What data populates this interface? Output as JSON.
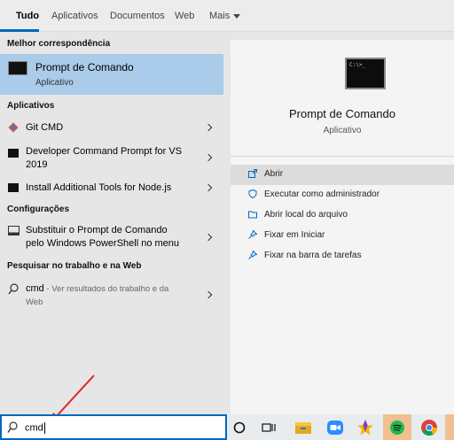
{
  "tabs": [
    {
      "label": "Tudo"
    },
    {
      "label": "Aplicativos"
    },
    {
      "label": "Documentos"
    },
    {
      "label": "Web"
    },
    {
      "label": "Mais"
    }
  ],
  "left": {
    "best_match_heading": "Melhor correspondência",
    "best_match": {
      "title": "Prompt de Comando",
      "subtitle": "Aplicativo"
    },
    "apps_heading": "Aplicativos",
    "apps": [
      {
        "label": "Git CMD"
      },
      {
        "line1": "Developer Command Prompt for VS",
        "line2": "2019"
      },
      {
        "label": "Install Additional Tools for Node.js"
      }
    ],
    "settings_heading": "Configurações",
    "setting": {
      "line1": "Substituir o Prompt de Comando",
      "line2": "pelo Windows PowerShell no menu"
    },
    "web_heading": "Pesquisar no trabalho e na Web",
    "web_result": {
      "query": "cmd",
      "suffix": " - Ver resultados do trabalho e da",
      "line2": "Web"
    }
  },
  "right": {
    "icon_text": "C:\\>_",
    "title": "Prompt de Comando",
    "subtitle": "Aplicativo",
    "actions": [
      {
        "label": "Abrir",
        "icon": "open-icon"
      },
      {
        "label": "Executar como administrador",
        "icon": "shield-icon"
      },
      {
        "label": "Abrir local do arquivo",
        "icon": "folder-icon"
      },
      {
        "label": "Fixar em Iniciar",
        "icon": "pin-icon"
      },
      {
        "label": "Fixar na barra de tarefas",
        "icon": "pin-icon"
      }
    ]
  },
  "search": {
    "value": "cmd"
  },
  "colors": {
    "accent": "#0067c0",
    "selected": "#aacbe9",
    "arrow": "#e02020"
  }
}
